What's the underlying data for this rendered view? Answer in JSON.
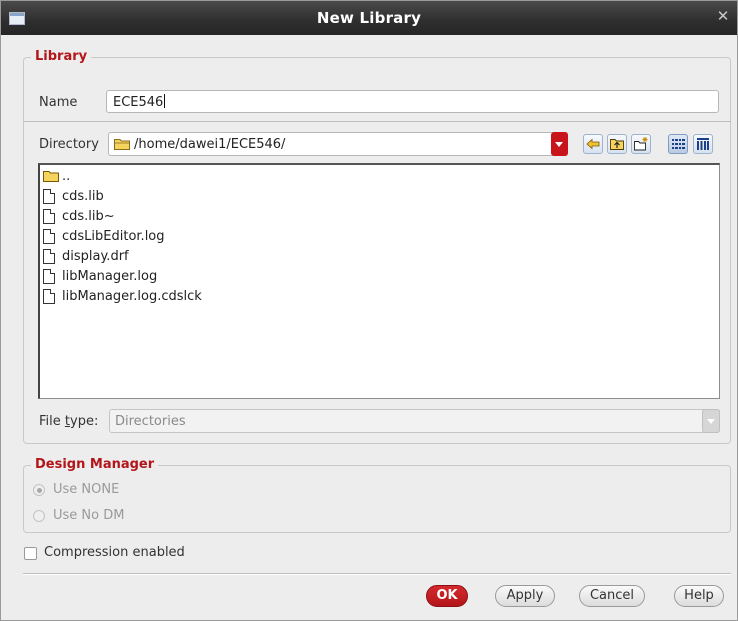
{
  "window": {
    "title": "New Library"
  },
  "library": {
    "legend": "Library",
    "name_label": "Name",
    "name_value": "ECE546",
    "directory_label": "Directory",
    "directory_value": "/home/dawei1/ECE546/",
    "files": [
      {
        "name": "..",
        "type": "folder"
      },
      {
        "name": "cds.lib",
        "type": "file"
      },
      {
        "name": "cds.lib~",
        "type": "file"
      },
      {
        "name": "cdsLibEditor.log",
        "type": "file"
      },
      {
        "name": "display.drf",
        "type": "file"
      },
      {
        "name": "libManager.log",
        "type": "file"
      },
      {
        "name": "libManager.log.cdslck",
        "type": "file"
      }
    ],
    "file_type_label_pre": "File ",
    "file_type_label_mnemonic": "t",
    "file_type_label_post": "ype:",
    "file_type_value": "Directories"
  },
  "design_manager": {
    "legend": "Design Manager",
    "option_none": "Use NONE",
    "option_no_dm": "Use No DM",
    "selected": "Use NONE"
  },
  "compression": {
    "label": "Compression enabled",
    "checked": false
  },
  "buttons": {
    "ok": "OK",
    "apply": "Apply",
    "cancel": "Cancel",
    "help": "Help"
  },
  "colors": {
    "accent": "#b3151a",
    "titlebar": "#2e2e2e"
  },
  "icons": {
    "back": "back-arrow-icon",
    "up": "up-folder-icon",
    "new_folder": "new-folder-icon",
    "list_view": "list-view-icon",
    "detail_view": "detail-view-icon"
  }
}
